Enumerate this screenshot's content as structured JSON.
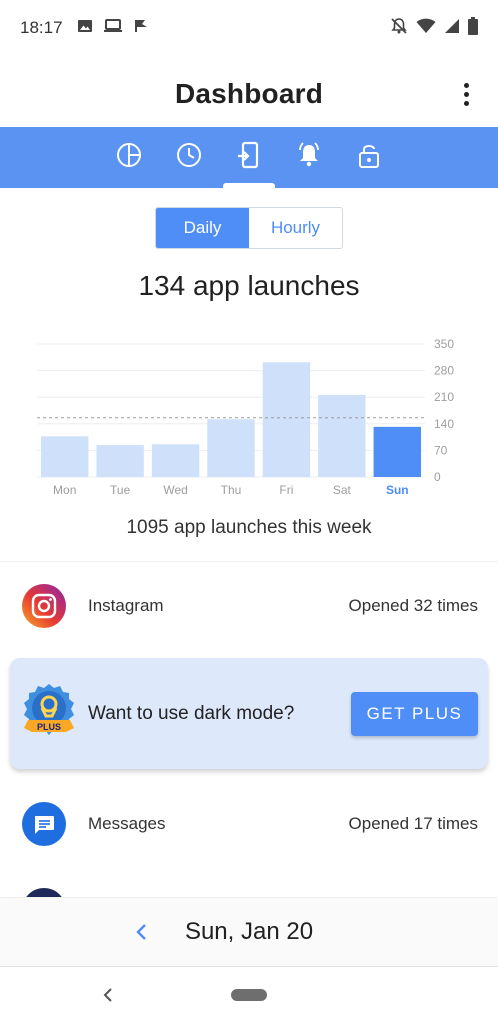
{
  "status_bar": {
    "time": "18:17",
    "left_icons": [
      "image-icon",
      "laptop-icon",
      "flag-icon"
    ],
    "right_icons": [
      "notifications-off-icon",
      "wifi-icon",
      "signal-icon",
      "battery-icon"
    ]
  },
  "app_bar": {
    "title": "Dashboard",
    "overflow_icon": "more-vert-icon"
  },
  "tabs": [
    {
      "icon": "pie-chart-icon",
      "selected": false
    },
    {
      "icon": "clock-icon",
      "selected": false
    },
    {
      "icon": "phone-launch-icon",
      "selected": true
    },
    {
      "icon": "bell-icon",
      "selected": false
    },
    {
      "icon": "lock-icon",
      "selected": false
    }
  ],
  "toggle": {
    "daily": "Daily",
    "hourly": "Hourly",
    "selected": "Daily"
  },
  "summary": {
    "title": "134 app launches",
    "week": "1095 app launches this week"
  },
  "chart_data": {
    "type": "bar",
    "categories": [
      "Mon",
      "Tue",
      "Wed",
      "Thu",
      "Fri",
      "Sat",
      "Sun"
    ],
    "values": [
      107,
      84,
      86,
      152,
      302,
      216,
      132
    ],
    "highlight_index": 6,
    "y_ticks": [
      0,
      70,
      140,
      210,
      280,
      350
    ],
    "ylim": [
      0,
      350
    ],
    "average": 156,
    "grid": true,
    "colors": {
      "bar": "#cfe0fb",
      "highlight": "#4f8ef7",
      "average_line": "#9e9e9e"
    }
  },
  "apps": [
    {
      "name": "Instagram",
      "count": "Opened 32 times",
      "icon": "instagram-icon"
    },
    {
      "name": "Messages",
      "count": "Opened 17 times",
      "icon": "messages-icon"
    }
  ],
  "promo": {
    "text": "Want to use dark mode?",
    "button": "GET PLUS",
    "badge_text": "PLUS"
  },
  "date_nav": {
    "label": "Sun, Jan 20"
  },
  "colors": {
    "accent": "#4f8ef7",
    "tab_strip": "#5a93f2",
    "promo_bg": "#dde8fb"
  }
}
